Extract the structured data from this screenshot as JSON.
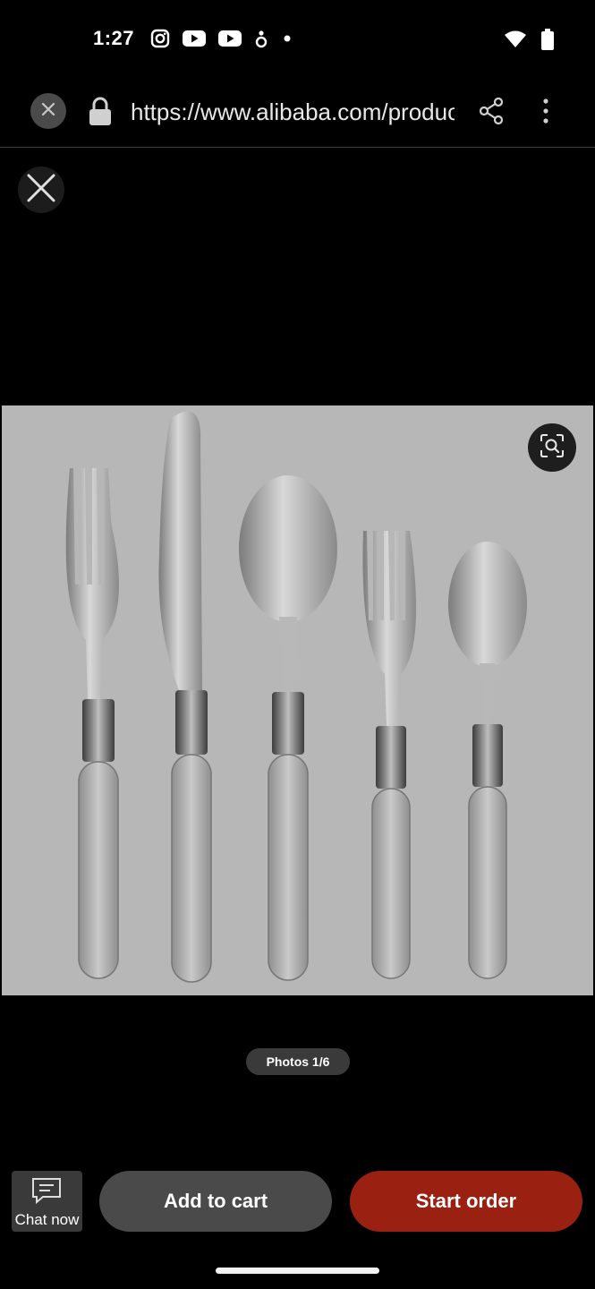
{
  "status_bar": {
    "time": "1:27",
    "left_icons": [
      "instagram-icon",
      "youtube-icon",
      "youtube-icon",
      "app-notification-icon",
      "dot-icon"
    ],
    "right_icons": [
      "wifi-icon",
      "battery-icon"
    ]
  },
  "browser": {
    "url": "https://www.alibaba.com/product-detail",
    "icons": [
      "close-icon",
      "lock-icon",
      "share-icon",
      "more-vert-icon"
    ]
  },
  "viewer": {
    "photo_counter": "Photos 1/6",
    "photo_subject": "cutlery set with clear handles",
    "photo_background": "#b7b7b7"
  },
  "actions": {
    "chat_label": "Chat now",
    "add_to_cart_label": "Add to cart",
    "start_order_label": "Start order",
    "start_order_color": "#9a2012"
  }
}
